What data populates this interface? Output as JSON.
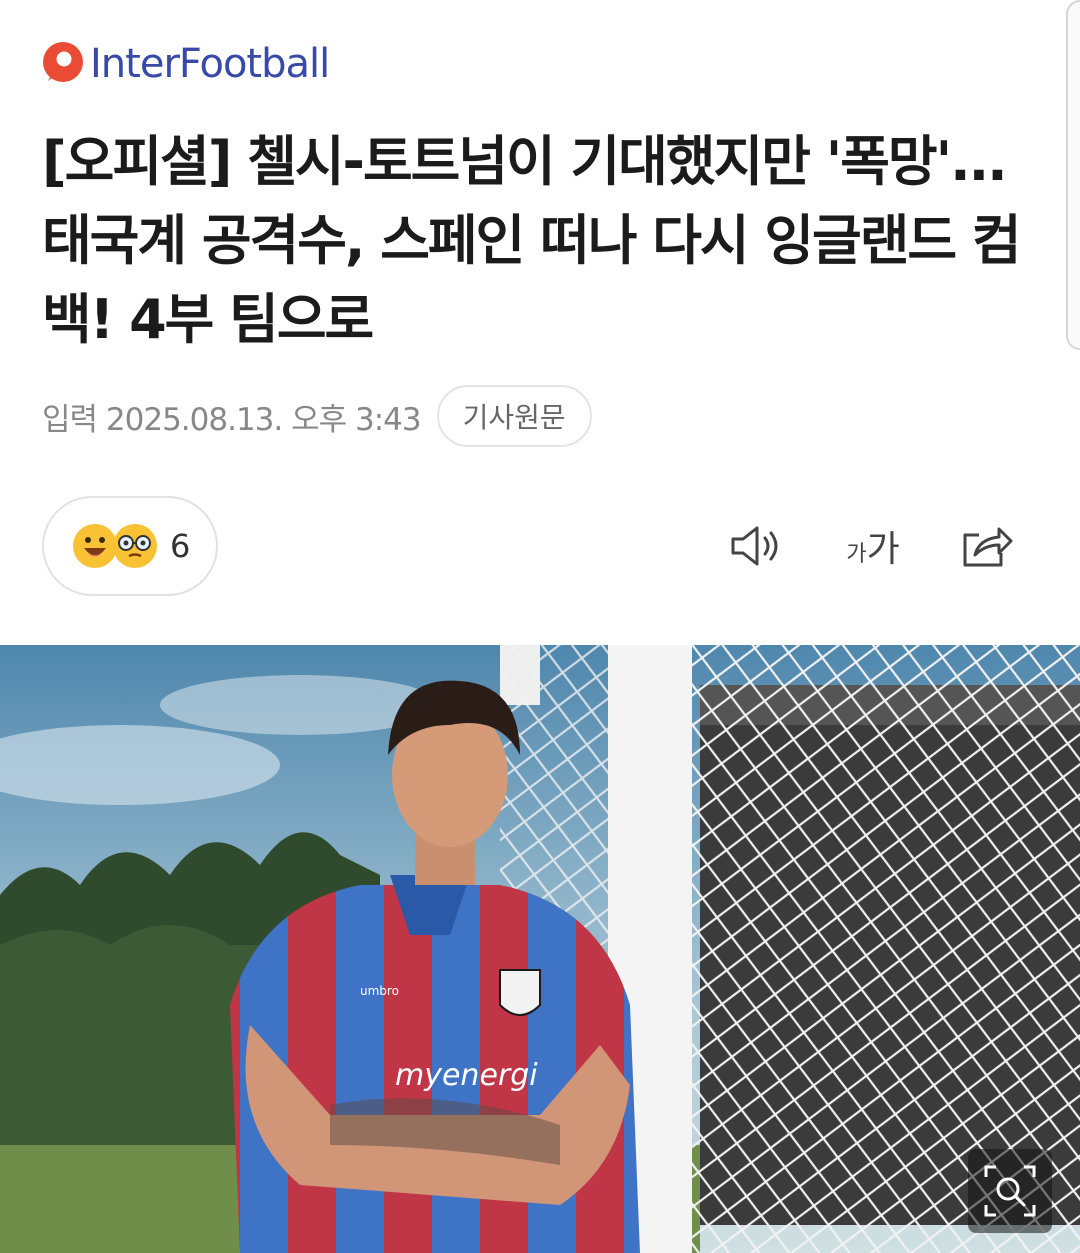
{
  "brand": {
    "logo_text": "InterFootball",
    "accent": "#e94b35",
    "logo_color": "#3949a8"
  },
  "article": {
    "title": "[오피셜] 첼시-토트넘이 기대했지만 '폭망'...태국계 공격수, 스페인 떠나 다시 잉글랜드 컴백! 4부 팀으로",
    "date": "입력 2025.08.13. 오후 3:43",
    "original_label": "기사원문"
  },
  "reactions": {
    "icons": [
      "smiling-face-icon",
      "glasses-face-icon"
    ],
    "count": "6"
  },
  "toolbar": {
    "tts": "speaker-icon",
    "font_size": "가가",
    "share": "share-icon"
  },
  "photo": {
    "sponsor": "myenergi",
    "kit_brand": "umbro",
    "zoom_icon": "zoom-icon"
  }
}
